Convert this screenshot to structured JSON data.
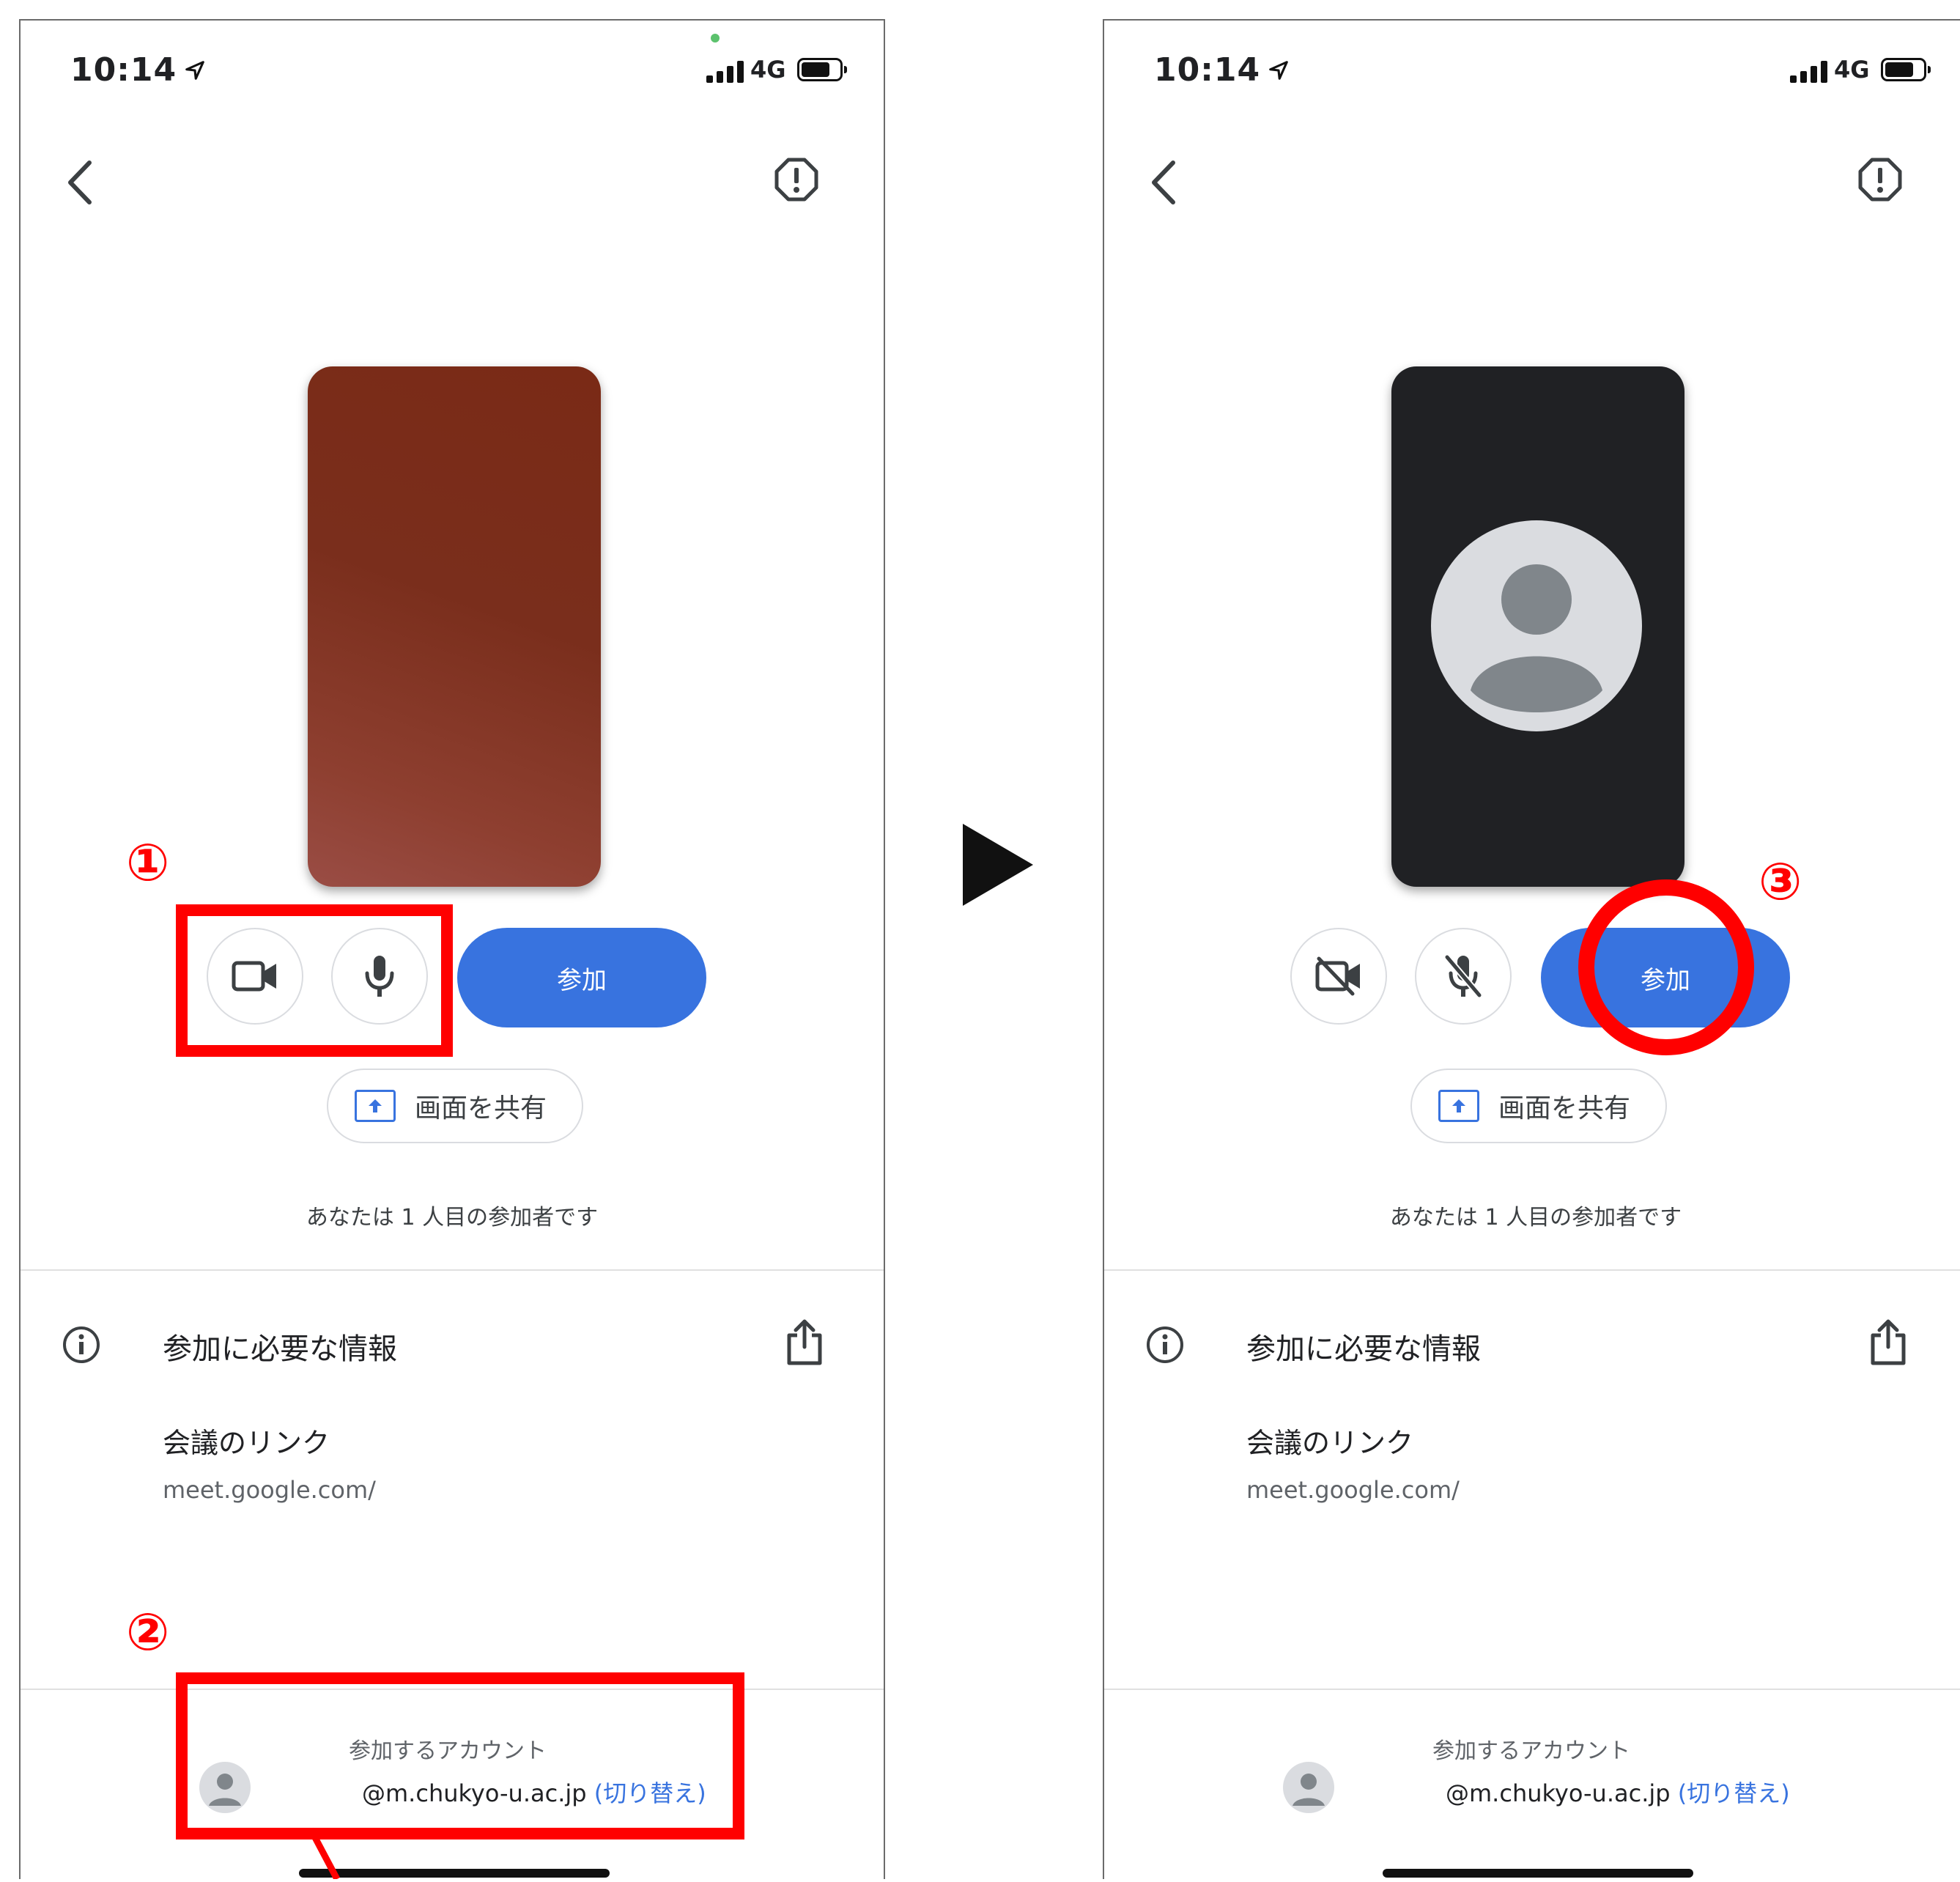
{
  "colors": {
    "accent": "#3873df",
    "highlight": "#ff0000"
  },
  "markers": {
    "one": "①",
    "two": "②",
    "three": "③"
  },
  "left_screen": {
    "status": {
      "time": "10:14",
      "network": "4G"
    },
    "camera_state": "on",
    "mic_state": "on",
    "join_label": "参加",
    "share_label": "画面を共有",
    "participant_text": "あなたは 1 人目の参加者です",
    "info": {
      "title": "参加に必要な情報",
      "link_label": "会議のリンク",
      "link_url": "meet.google.com/"
    },
    "account": {
      "label": "参加するアカウント",
      "email": "@m.chukyo-u.ac.jp",
      "paren_open": "(",
      "switch": "切り替え",
      "paren_close": ")"
    }
  },
  "right_screen": {
    "status": {
      "time": "10:14",
      "network": "4G"
    },
    "camera_state": "off",
    "mic_state": "off",
    "join_label": "参加",
    "share_label": "画面を共有",
    "participant_text": "あなたは 1 人目の参加者です",
    "info": {
      "title": "参加に必要な情報",
      "link_label": "会議のリンク",
      "link_url": "meet.google.com/"
    },
    "account": {
      "label": "参加するアカウント",
      "email": "@m.chukyo-u.ac.jp",
      "paren_open": "(",
      "switch": "切り替え",
      "paren_close": ")"
    }
  }
}
